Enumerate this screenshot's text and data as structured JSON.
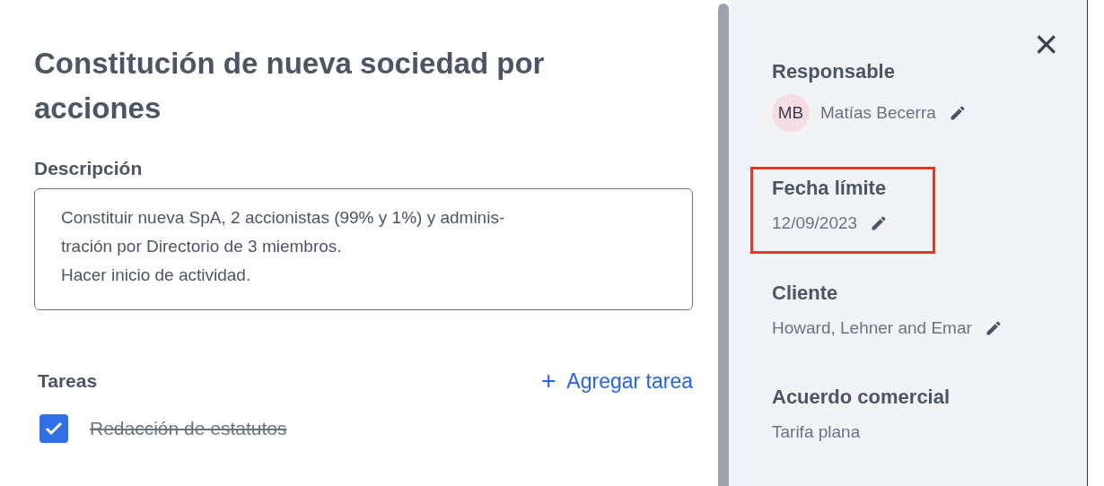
{
  "task": {
    "title": "Constitución de nueva sociedad por acciones",
    "description_label": "Descripción",
    "description": "Constituir nueva SpA, 2 accionistas (99% y 1%) y adminis-\ntración por Directorio de 3 miembros.\nHacer inicio de actividad.",
    "tasks_label": "Tareas",
    "add_task": {
      "icon": "+",
      "label": "Agregar tarea"
    },
    "tasks": [
      {
        "label": "Redacción de estatutos",
        "checked": true
      }
    ]
  },
  "details": {
    "close": "×",
    "fields": [
      {
        "label": "Responsable",
        "value": "Matías Becerra",
        "avatar": "MB",
        "editable": true,
        "highlighted": false
      },
      {
        "label": "Fecha límite",
        "value": "12/09/2023",
        "editable": true,
        "highlighted": true
      },
      {
        "label": "Cliente",
        "value": "Howard, Lehner and Emar",
        "editable": true,
        "highlighted": false
      },
      {
        "label": "Acuerdo comercial",
        "value": "Tarifa plana",
        "editable": false,
        "highlighted": false
      }
    ]
  }
}
